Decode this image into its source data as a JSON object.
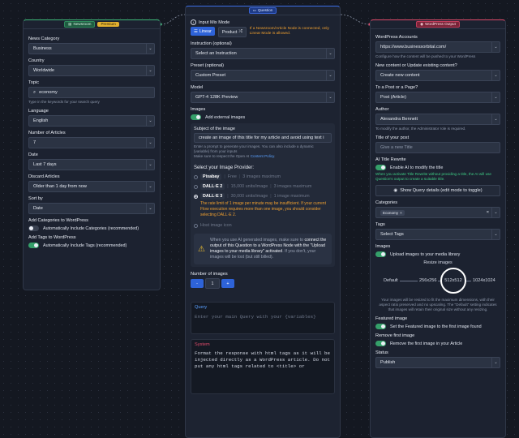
{
  "newsroom": {
    "tag": "Newsroom",
    "premium": "Premium",
    "category_label": "News Category",
    "category_value": "Business",
    "country_label": "Country",
    "country_value": "Worldwide",
    "topic_label": "Topic",
    "topic_value": "economy",
    "topic_hint": "Type in the keywords for your search query",
    "language_label": "Language",
    "language_value": "English",
    "articles_label": "Number of Articles",
    "articles_value": "7",
    "date_label": "Date",
    "date_value": "Last 7 days",
    "discard_label": "Discard Articles",
    "discard_value": "Older than 1 day from now",
    "sort_label": "Sort by",
    "sort_value": "Date",
    "add_cat_label": "Add Categories to WordPress",
    "add_cat_toggle": "Automatically Include Categories (recommended)",
    "add_tags_label": "Add Tags to WordPress",
    "add_tags_toggle": "Automatically Include Tags (recommended)"
  },
  "question": {
    "tag": "Question",
    "input_mix_label": "Input Mix Mode",
    "linear_btn": "Linear",
    "product_btn": "Product",
    "mix_note": "If a Newsroom/Article Node is connected, only Linear Mode is allowed.",
    "instruction_label": "Instruction (optional)",
    "instruction_value": "Select an Instruction",
    "preset_label": "Preset (optional)",
    "preset_value": "Custom Preset",
    "model_label": "Model",
    "model_value": "GPT-4 128K Preview",
    "images_label": "Images",
    "add_external": "Add external images",
    "subject_label": "Subject of the image",
    "subject_value": "create an image of this title for my article and avoid using text i",
    "subject_hint1": "Enter a prompt to generate your images. You can also include a dynamic",
    "subject_hint2": "{variable} from your inputs",
    "subject_hint3": "Make sure to respect the Open AI ",
    "policy_link": "Content Policy",
    "provider_label": "Select your Image Provider:",
    "providers": [
      {
        "name": "Pixabay",
        "a": "Free",
        "b": "3 images maximum"
      },
      {
        "name": "DALL·E 2",
        "a": "15,000 units/image",
        "b": "3 images maximum"
      },
      {
        "name": "DALL·E 3",
        "a": "30,000 units/image",
        "b": "1 image maximum"
      }
    ],
    "warn_text": "The rate limit of 1 image per minute may be insufficient. If your current Flow execution requires more than one image, you should consider selecting DALL·E 2.",
    "host_label": "Host image icon",
    "notice_a": "When you use AI generated images, make sure to ",
    "notice_b": "connect the output of this Question to a WordPress Node with the \"Upload images to your media library\" activated",
    "notice_c": ". If you don't, your images will be lost (but still billed).",
    "num_images_label": "Number of images",
    "minus": "-",
    "num_value": "1",
    "plus": "+",
    "query_label": "Query",
    "query_placeholder": "Enter your main Query with your {variables}",
    "system_label": "System",
    "system_text": "Format the response with html tags as it will be injected directly as a WordPress article. Do not put any html tags related to <title> or"
  },
  "wordpress": {
    "tag": "WordPress Output",
    "accounts_label": "WordPress Accounts",
    "accounts_value": "https://www.businessorbital.com/",
    "accounts_hint": "Configure how the content will be pushed to your WordPress",
    "new_content_label": "New content or Update existing content?",
    "new_content_value": "Create new content",
    "post_label": "To a Post or a Page?",
    "post_value": "Post (Article)",
    "author_label": "Author",
    "author_value": "Alexandra Bennett",
    "author_hint": "To modify the author, the Administrator role is required.",
    "title_label": "Title of your post",
    "title_placeholder": "Give a new Title",
    "rewrite_label": "AI Title Rewrite",
    "rewrite_toggle": "Enable AI to modify the title",
    "rewrite_hint": "When you activate Title Rewrite without providing a title, the AI will use Question's output to create a suitable title.",
    "query_details": "Show Query details (edit mode to toggle)",
    "categories_label": "Categories",
    "categories_chip": "Economy",
    "tags_label": "Tags",
    "tags_value": "Select Tags",
    "images_label": "Images",
    "upload_toggle": "Upload images to your media library",
    "resize_label": "Resize images",
    "sizes": [
      "Default",
      "256x256",
      "512x512",
      "1024x1024"
    ],
    "resize_hint": "Your images will be resized to fit the maximum dimensions, with their aspect ratio preserved and no upscaling. The \"Default\" setting indicates that images will retain their original size without any resizing.",
    "featured_label": "Featured image",
    "featured_toggle": "Set the Featured image to the first image found",
    "remove_label": "Remove first image",
    "remove_toggle": "Remove the first image in your Article",
    "status_label": "Status",
    "status_value": "Publish"
  },
  "colors": {
    "accent_blue": "#2e63d8",
    "toggle_on": "#35a06a",
    "warning": "#f0a030",
    "link": "#5aa0ff"
  }
}
